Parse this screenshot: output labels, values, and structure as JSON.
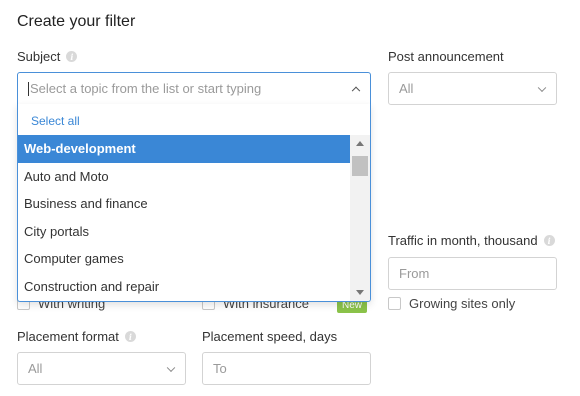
{
  "page": {
    "title": "Create your filter"
  },
  "subject": {
    "label": "Subject",
    "placeholder": "Select a topic from the list or start typing",
    "select_all": "Select all",
    "options": [
      "Web-development",
      "Auto and Moto",
      "Business and finance",
      "City portals",
      "Computer games",
      "Construction and repair"
    ],
    "selected": "Web-development"
  },
  "post_announcement": {
    "label": "Post announcement",
    "value": "All"
  },
  "traffic": {
    "label": "Traffic in month, thousand",
    "placeholder": "From"
  },
  "checkboxes": {
    "with_writing": "With writing",
    "with_insurance": "With insurance",
    "new_badge": "New",
    "growing_sites": "Growing sites only"
  },
  "placement_format": {
    "label": "Placement format",
    "value": "All"
  },
  "placement_speed": {
    "label": "Placement speed, days",
    "placeholder": "To"
  },
  "colors": {
    "accent": "#3a87d6",
    "focus_border": "#4a90d9",
    "badge": "#8bc34a"
  }
}
